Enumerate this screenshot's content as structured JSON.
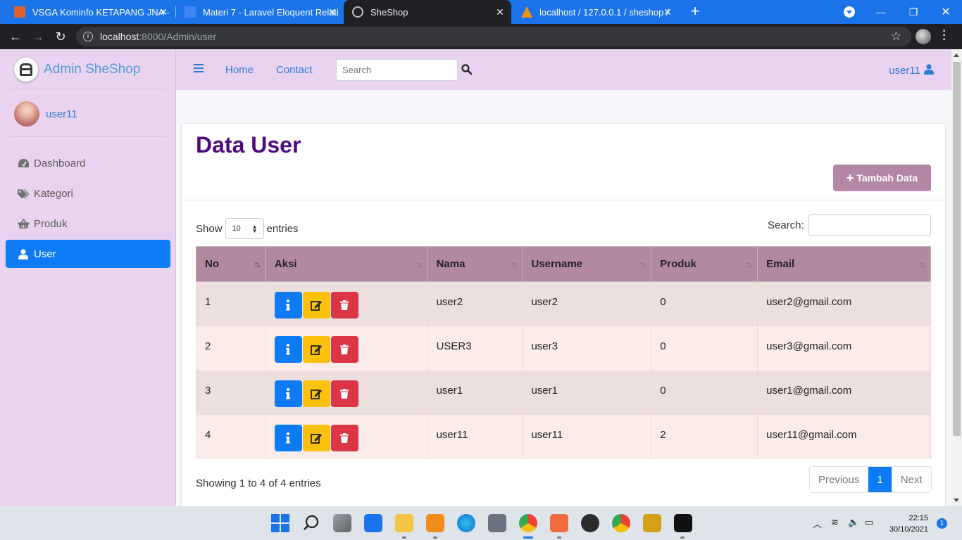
{
  "browser": {
    "tabs": [
      {
        "title": "VSGA Kominfo KETAPANG JNA -",
        "favicon_color": "#e2612a"
      },
      {
        "title": "Materi 7 - Laravel Eloquent Relati",
        "favicon_color": "#4285f4"
      },
      {
        "title": "SheShop",
        "favicon_color": "#bdc1c6"
      },
      {
        "title": "localhost / 127.0.0.1 / sheshop / ",
        "favicon_color": "#f29111"
      }
    ],
    "url_host": "localhost",
    "url_path": ":8000/Admin/user"
  },
  "sidebar": {
    "brand": "Admin SheShop",
    "user": "user11",
    "items": [
      {
        "label": "Dashboard",
        "icon": "tachometer-icon"
      },
      {
        "label": "Kategori",
        "icon": "tags-icon"
      },
      {
        "label": "Produk",
        "icon": "basket-icon"
      },
      {
        "label": "User",
        "icon": "user-icon"
      }
    ]
  },
  "navbar": {
    "home": "Home",
    "contact": "Contact",
    "search_placeholder": "Search",
    "user": "user11"
  },
  "main": {
    "title": "Data User",
    "add_button": "Tambah Data",
    "show_label": "Show",
    "entries_label": "entries",
    "length_value": "10",
    "search_label": "Search:",
    "columns": [
      "No",
      "Aksi",
      "Nama",
      "Username",
      "Produk",
      "Email"
    ],
    "rows": [
      {
        "no": "1",
        "nama": "user2",
        "username": "user2",
        "produk": "0",
        "email": "user2@gmail.com"
      },
      {
        "no": "2",
        "nama": "USER3",
        "username": "user3",
        "produk": "0",
        "email": "user3@gmail.com"
      },
      {
        "no": "3",
        "nama": "user1",
        "username": "user1",
        "produk": "0",
        "email": "user1@gmail.com"
      },
      {
        "no": "4",
        "nama": "user11",
        "username": "user11",
        "produk": "2",
        "email": "user11@gmail.com"
      }
    ],
    "info": "Showing 1 to 4 of 4 entries",
    "pagination": {
      "previous": "Previous",
      "page": "1",
      "next": "Next"
    }
  },
  "colors": {
    "sidebar_bg": "#e9d3f0",
    "title": "#4f0b7b",
    "header_row": "#b18aa2",
    "primary": "#0d7bf5",
    "warning": "#fbc10d",
    "danger": "#dc3545"
  },
  "taskbar": {
    "time": "22:15",
    "date": "30/10/2021",
    "notifications": "1"
  }
}
